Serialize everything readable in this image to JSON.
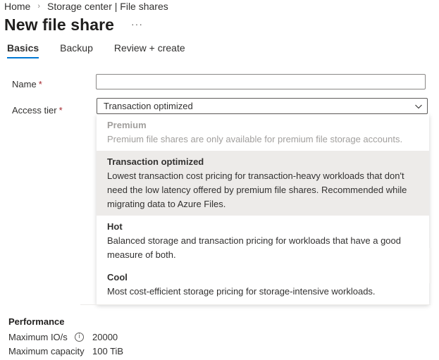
{
  "breadcrumb": {
    "home": "Home",
    "separator": "›",
    "current": "Storage center | File shares"
  },
  "page": {
    "title": "New file share",
    "more": "···"
  },
  "tabs": [
    {
      "label": "Basics",
      "active": true
    },
    {
      "label": "Backup",
      "active": false
    },
    {
      "label": "Review + create",
      "active": false
    }
  ],
  "form": {
    "name_label": "Name",
    "name_value": "",
    "required_mark": "*",
    "access_tier_label": "Access tier",
    "access_tier_value": "Transaction optimized"
  },
  "dropdown": {
    "options": [
      {
        "title": "Premium",
        "desc": "Premium file shares are only available for premium file storage accounts.",
        "disabled": true
      },
      {
        "title": "Transaction optimized",
        "desc1": "Lowest transaction cost pricing for transaction-heavy workloads that don't",
        "desc2": "need the low latency offered by premium file shares. Recommended while",
        "desc3": "migrating data to Azure Files.",
        "selected": true
      },
      {
        "title": "Hot",
        "desc1": "Balanced storage and transaction pricing for workloads that have a good",
        "desc2": "measure of both."
      },
      {
        "title": "Cool",
        "desc": "Most cost-efficient storage pricing for storage-intensive workloads."
      }
    ]
  },
  "performance": {
    "heading": "Performance",
    "max_io_label": "Maximum IO/s",
    "info_icon": "info-icon",
    "max_io_value": "20000",
    "max_capacity_label": "Maximum capacity",
    "max_capacity_value": "100 TiB"
  },
  "colors": {
    "accent": "#0078d4",
    "required": "#a4262c",
    "selected_bg": "#edebe9"
  }
}
